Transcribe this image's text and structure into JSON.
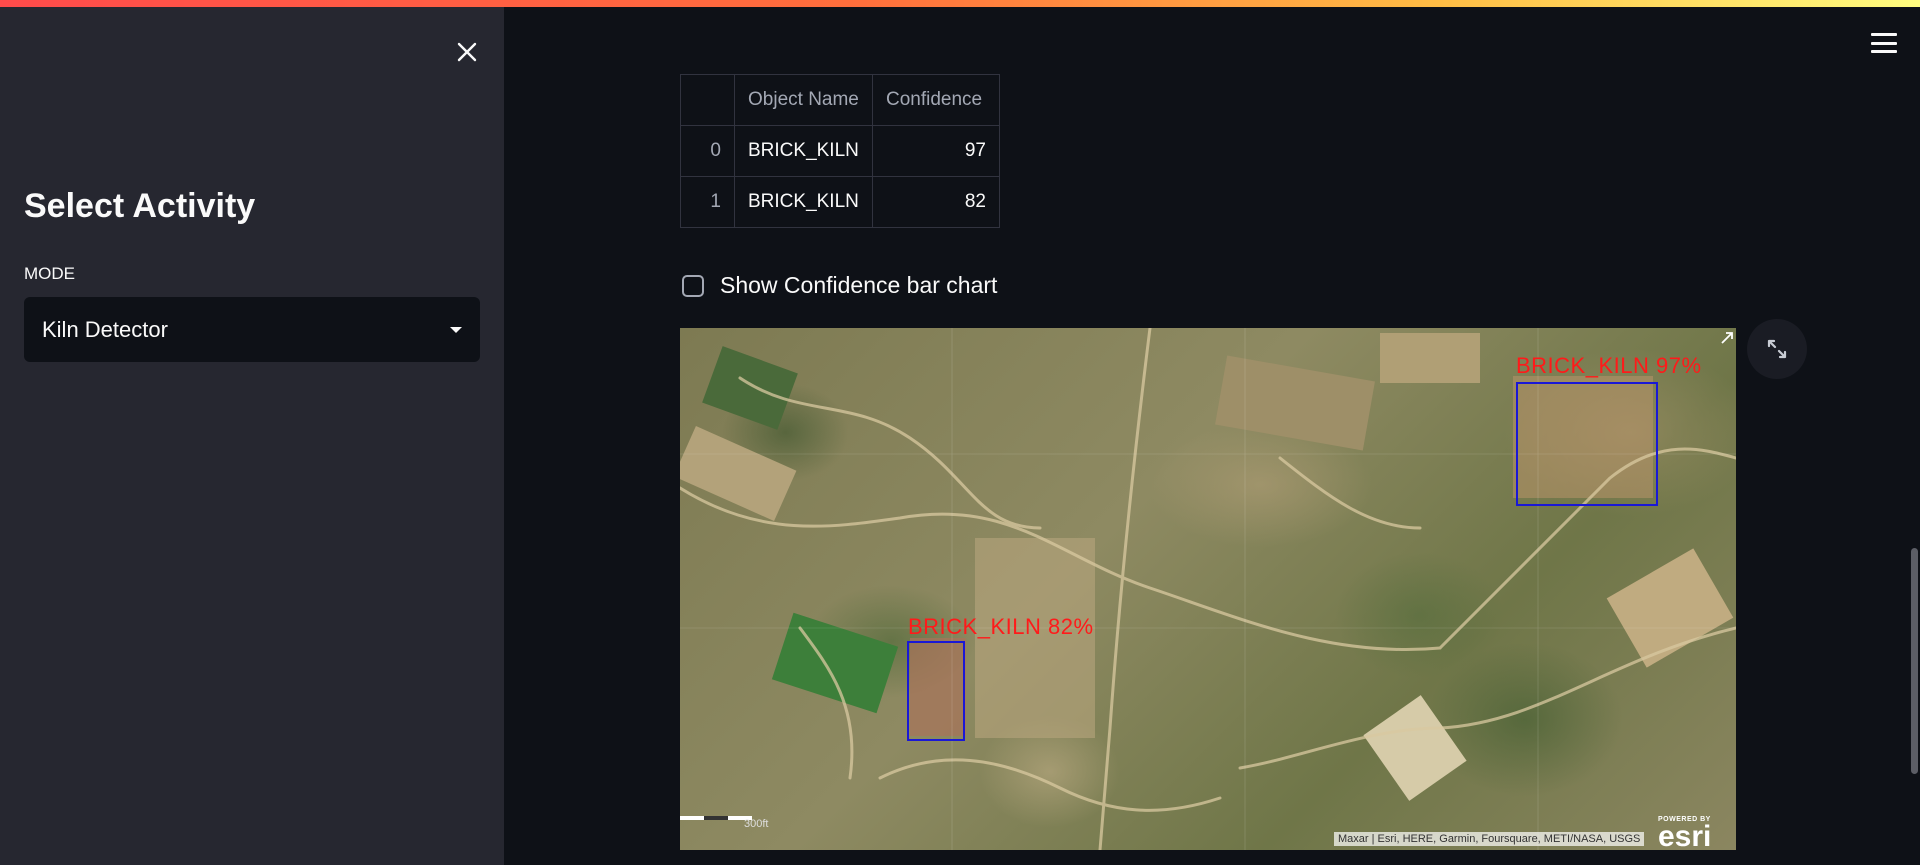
{
  "sidebar": {
    "title": "Select Activity",
    "mode_label": "MODE",
    "mode_value": "Kiln Detector",
    "close_icon": "close-icon"
  },
  "header": {
    "menu_icon": "hamburger-menu-icon"
  },
  "table": {
    "columns": [
      "",
      "Object Name",
      "Confidence"
    ],
    "rows": [
      {
        "index": "0",
        "object_name": "BRICK_KILN",
        "confidence": "97"
      },
      {
        "index": "1",
        "object_name": "BRICK_KILN",
        "confidence": "82"
      }
    ]
  },
  "checkbox": {
    "label": "Show Confidence bar chart",
    "checked": false
  },
  "map": {
    "detections": [
      {
        "label": "BRICK_KILN  97%"
      },
      {
        "label": "BRICK_KILN  82%"
      }
    ],
    "attribution": "Maxar | Esri, HERE, Garmin, Foursquare, METI/NASA, USGS",
    "logo_powered_by": "POWERED BY",
    "logo_name": "esri",
    "scale_text": "300ft",
    "expand_icon": "expand-icon"
  },
  "colors": {
    "accent": "#ff4b4b",
    "sidebar_bg": "#262730",
    "main_bg": "#0e1117",
    "box_color": "#1a18d6",
    "label_color": "#ff1a1a"
  }
}
